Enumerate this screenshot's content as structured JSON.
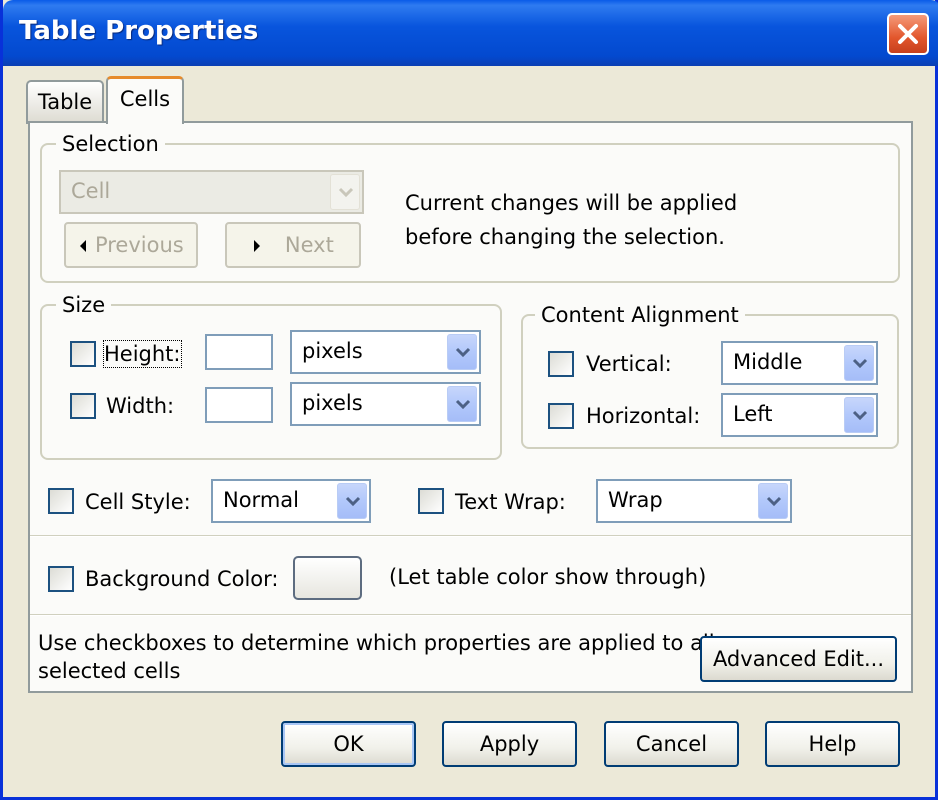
{
  "window": {
    "title": "Table Properties"
  },
  "tabs": [
    {
      "label": "Table"
    },
    {
      "label": "Cells"
    }
  ],
  "selection": {
    "legend": "Selection",
    "dropdown_value": "Cell",
    "previous_label": "Previous",
    "next_label": "Next",
    "info_line1": "Current changes will be applied",
    "info_line2": "before changing the selection."
  },
  "size": {
    "legend": "Size",
    "height_label": "Height:",
    "width_label": "Width:",
    "height_value": "",
    "width_value": "",
    "height_unit": "pixels",
    "width_unit": "pixels"
  },
  "alignment": {
    "legend": "Content Alignment",
    "vertical_label": "Vertical:",
    "vertical_value": "Middle",
    "horizontal_label": "Horizontal:",
    "horizontal_value": "Left"
  },
  "style": {
    "cell_style_label": "Cell Style:",
    "cell_style_value": "Normal",
    "text_wrap_label": "Text Wrap:",
    "text_wrap_value": "Wrap"
  },
  "background": {
    "label": "Background Color:",
    "note": "(Let table color show through)"
  },
  "footer": {
    "hint_line1": "Use checkboxes to determine which properties are applied to all",
    "hint_line2": "selected cells",
    "advanced_edit_label": "Advanced Edit..."
  },
  "buttons": {
    "ok": "OK",
    "apply": "Apply",
    "cancel": "Cancel",
    "help": "Help"
  },
  "colors": {
    "titlebar": "#0855dd",
    "dialog_bg": "#ece9d8",
    "panel_bg": "#fbfbf9",
    "tab_highlight": "#e68b2c"
  },
  "icons": {
    "close": "close-icon",
    "dropdown": "chevron-down-icon",
    "prev": "triangle-left-icon",
    "next": "triangle-right-icon"
  }
}
